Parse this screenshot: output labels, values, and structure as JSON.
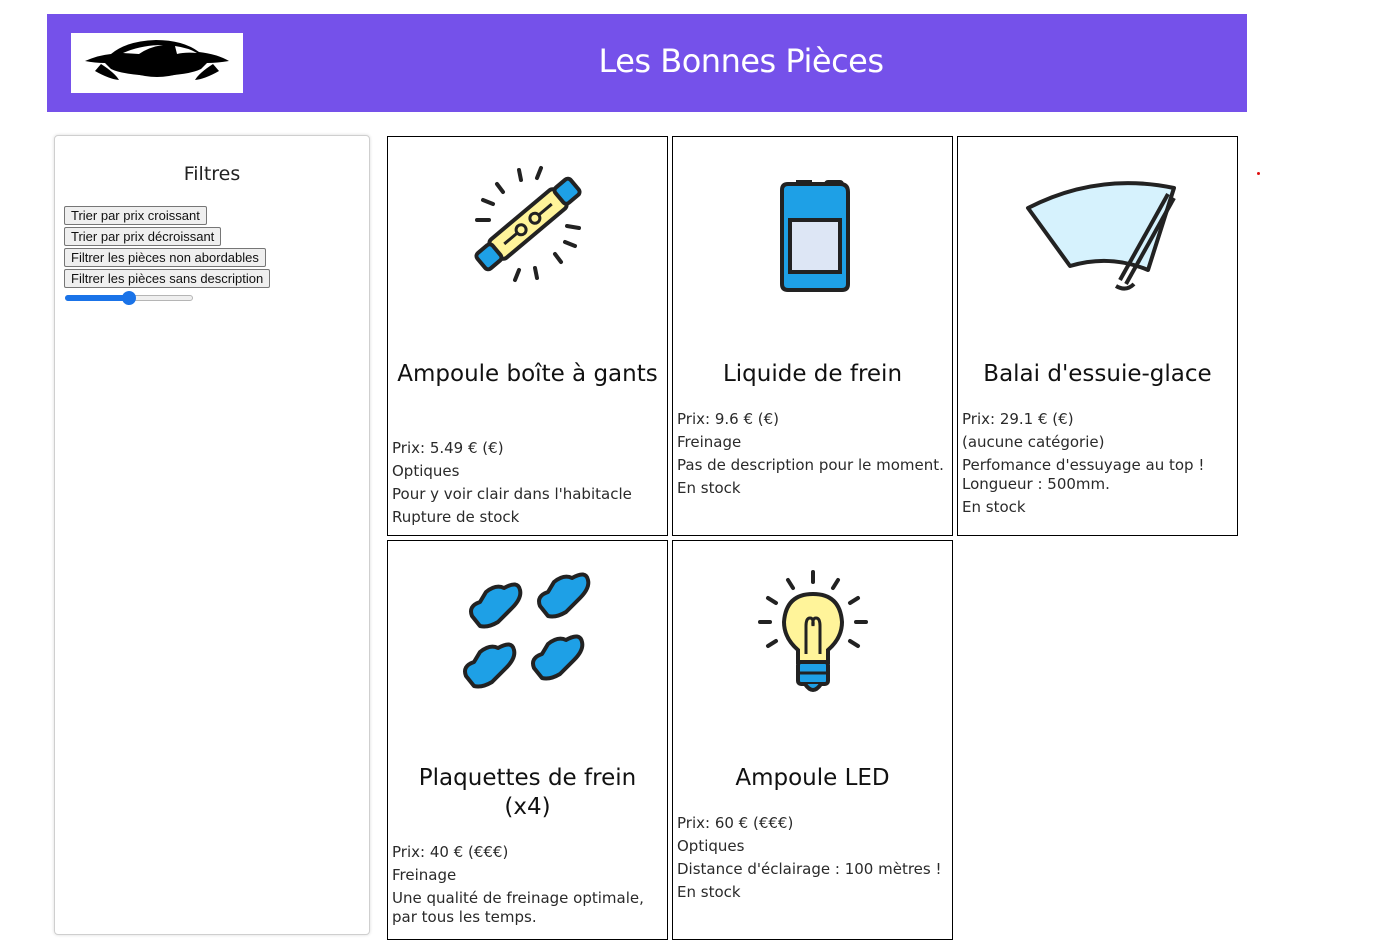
{
  "header": {
    "title": "Les Bonnes Pièces",
    "logo_icon": "car-silhouette-icon",
    "background": "#7551ea"
  },
  "filters": {
    "title": "Filtres",
    "buttons": [
      "Trier par prix croissant",
      "Trier par prix décroissant",
      "Filtrer les pièces non abordables",
      "Filtrer les pièces sans description"
    ],
    "slider_fraction": 0.5,
    "slider_color": "#1a73e8"
  },
  "products": [
    {
      "icon": "glovebox-bulb-icon",
      "name": "Ampoule boîte à gants",
      "price": "Prix: 5.49 € (€)",
      "category": "Optiques",
      "description": "Pour y voir clair dans l'habitacle",
      "stock": "Rupture de stock"
    },
    {
      "icon": "brake-fluid-can-icon",
      "name": "Liquide de frein",
      "price": "Prix: 9.6 € (€)",
      "category": "Freinage",
      "description": "Pas de description pour le moment.",
      "stock": "En stock"
    },
    {
      "icon": "wiper-blade-icon",
      "name": "Balai d'essuie-glace",
      "price": "Prix: 29.1 € (€)",
      "category": "(aucune catégorie)",
      "description": "Perfomance d'essuyage au top ! Longueur : 500mm.",
      "stock": "En stock"
    },
    {
      "icon": "brake-pads-icon",
      "name": "Plaquettes de frein (x4)",
      "price": "Prix: 40 € (€€€)",
      "category": "Freinage",
      "description": "Une qualité de freinage optimale, par tous les temps.",
      "stock": ""
    },
    {
      "icon": "led-bulb-icon",
      "name": "Ampoule LED",
      "price": "Prix: 60 € (€€€)",
      "category": "Optiques",
      "description": "Distance d'éclairage : 100 mètres !",
      "stock": "En stock"
    }
  ]
}
